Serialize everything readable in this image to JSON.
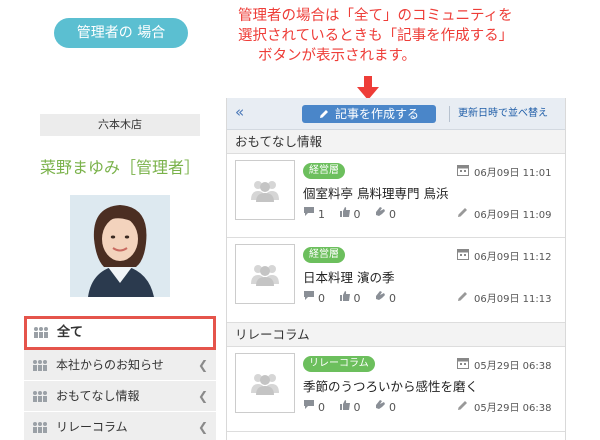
{
  "annotation": {
    "role_badge": "管理者の 場合",
    "note_lines": [
      "管理者の場合は「全て」のコミュニティを",
      "選択されているときも「記事を作成する」",
      "ボタンが表示されます。"
    ],
    "note_color": "#ee3d38",
    "badge_color": "#5bbfd1"
  },
  "sidebar": {
    "store_name": "六本木店",
    "user_name": "菜野まゆみ［管理者］",
    "nav": [
      {
        "label": "全て",
        "active": true,
        "icon": "people-icon"
      },
      {
        "label": "本社からのお知らせ",
        "icon": "people-icon"
      },
      {
        "label": "おもてなし情報",
        "icon": "people-icon"
      },
      {
        "label": "リレーコラム",
        "icon": "people-icon"
      }
    ],
    "active_highlight_color": "#e5544b"
  },
  "toolbar": {
    "collapse_icon": "«",
    "create_label": "記事を作成する",
    "sort_label": "更新日時で並べ替え",
    "create_color": "#4a86c9"
  },
  "sections": [
    {
      "heading": "おもてなし情報",
      "posts": [
        {
          "category": "経営層",
          "date": "06月09日 11:01",
          "title": "個室料亭 鳥料理専門 鳥浜",
          "comments": "1",
          "likes": "0",
          "claps": "0",
          "updated": "06月09日 11:09"
        },
        {
          "category": "経営層",
          "date": "06月09日 11:12",
          "title": "日本料理 濱の季",
          "comments": "0",
          "likes": "0",
          "claps": "0",
          "updated": "06月09日 11:13"
        }
      ]
    },
    {
      "heading": "リレーコラム",
      "posts": [
        {
          "category": "リレーコラム",
          "date": "05月29日 06:38",
          "title": "季節のうつろいから感性を磨く",
          "comments": "0",
          "likes": "0",
          "claps": "0",
          "updated": "05月29日 06:38"
        }
      ]
    }
  ],
  "category_color": "#6cbf5d"
}
